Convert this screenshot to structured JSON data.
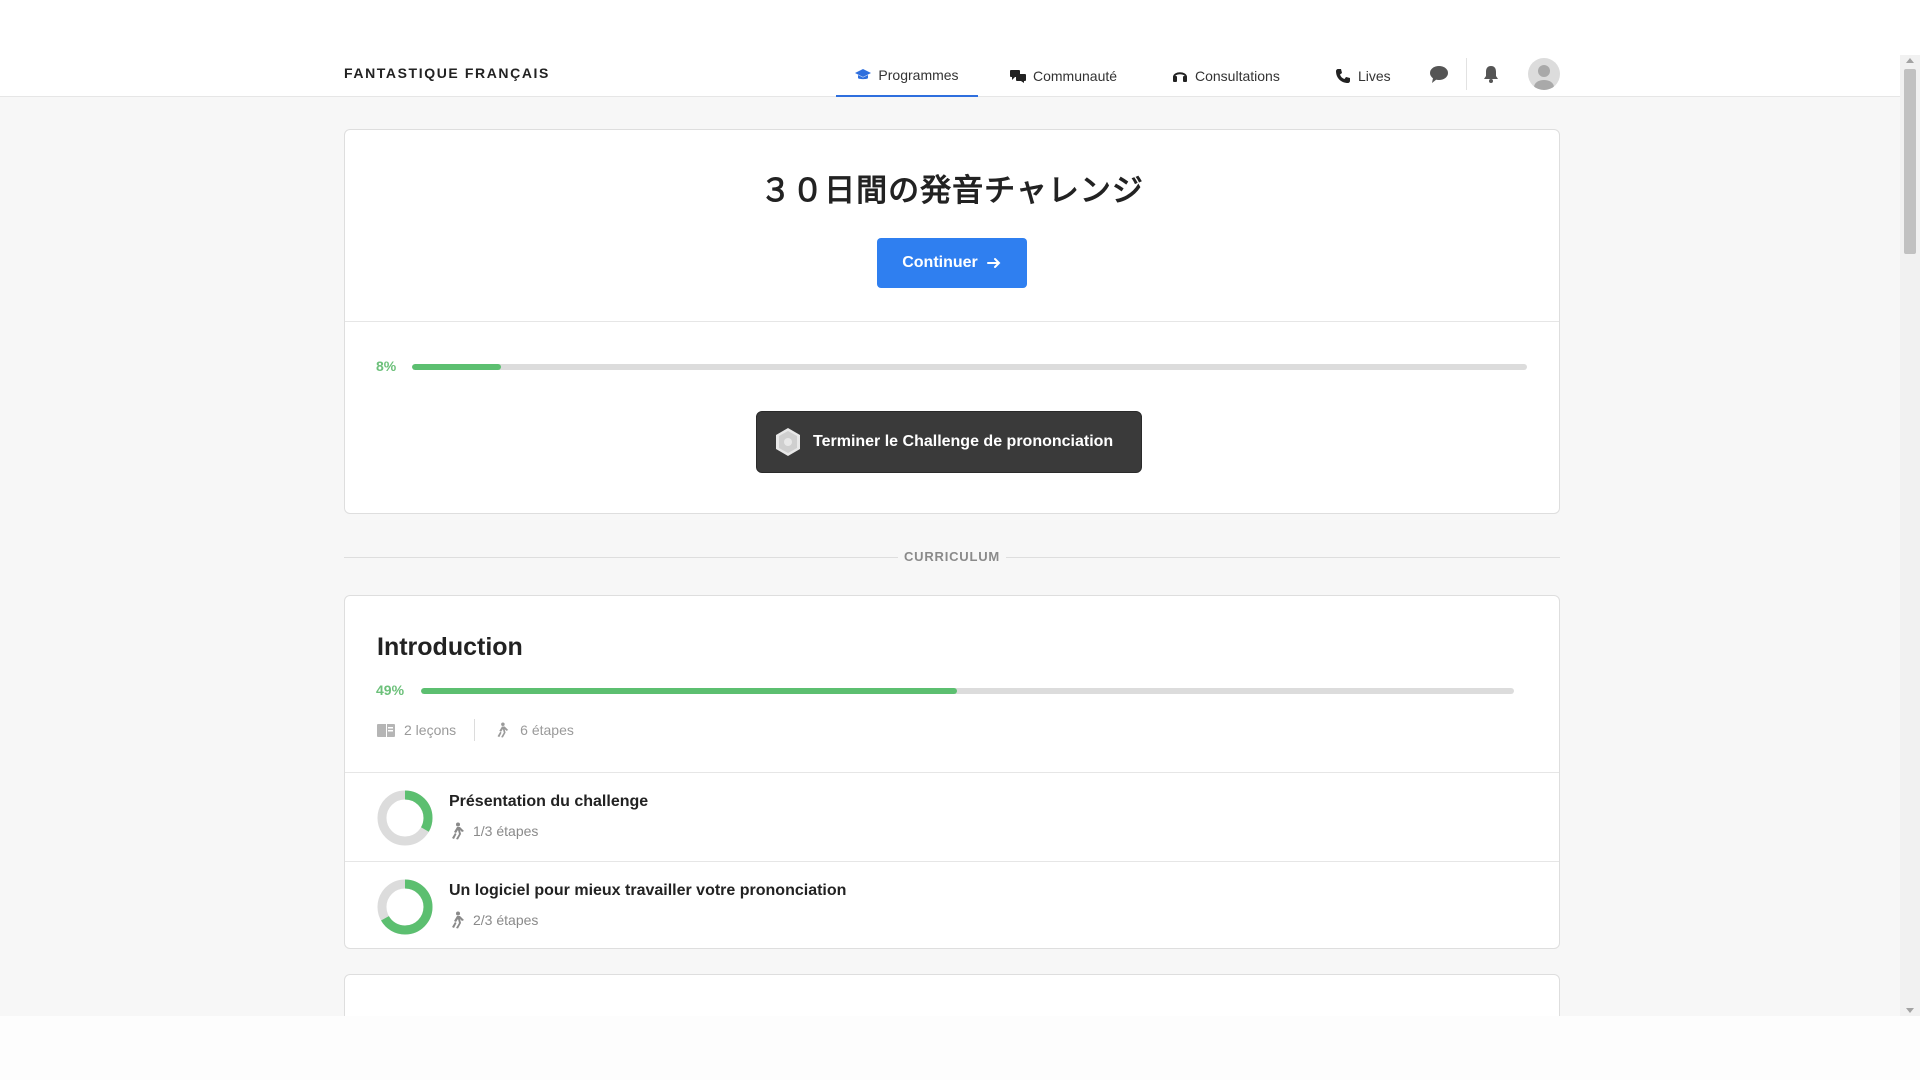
{
  "header": {
    "brand": "FANTASTIQUE FRANÇAIS",
    "nav": [
      {
        "label": "Programmes",
        "icon": "graduation-cap-icon",
        "active": true
      },
      {
        "label": "Communauté",
        "icon": "chat-bubbles-icon",
        "active": false
      },
      {
        "label": "Consultations",
        "icon": "headset-icon",
        "active": false
      },
      {
        "label": "Lives",
        "icon": "phone-icon",
        "active": false
      }
    ],
    "icons": [
      "message-icon",
      "bell-icon",
      "avatar"
    ]
  },
  "hero": {
    "title": "３０日間の発音チャレンジ",
    "continue_label": "Continuer",
    "progress_label": "8%",
    "progress_value": 0.08,
    "complete_label": "Terminer le Challenge de prononciation"
  },
  "curriculum": {
    "label": "CURRICULUM"
  },
  "sections": [
    {
      "title": "Introduction",
      "progress_label": "49%",
      "progress_value": 0.49,
      "lessons_count": "2 leçons",
      "steps_count": "6 étapes",
      "lessons": [
        {
          "title": "Présentation du challenge",
          "steps": "1/3 étapes",
          "progress": 0.333
        },
        {
          "title": "Un logiciel pour mieux travailler votre prononciation",
          "steps": "2/3 étapes",
          "progress": 0.667
        }
      ]
    }
  ],
  "colors": {
    "accent": "#2f7ff0",
    "progress": "#5cbf70",
    "dark_button": "#3a3a3a"
  }
}
